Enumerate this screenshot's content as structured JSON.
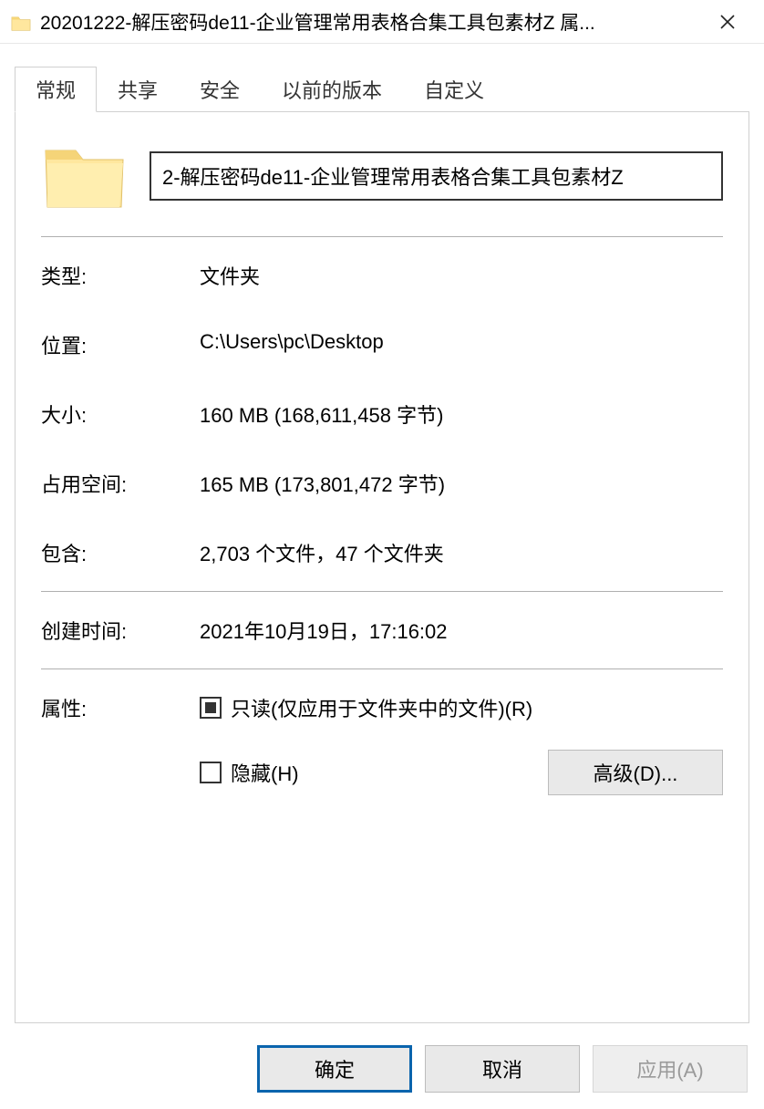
{
  "titlebar": {
    "title": "20201222-解压密码de11-企业管理常用表格合集工具包素材Z 属..."
  },
  "tabs": {
    "general": "常规",
    "sharing": "共享",
    "security": "安全",
    "previous": "以前的版本",
    "custom": "自定义"
  },
  "nameField": "2-解压密码de11-企业管理常用表格合集工具包素材Z",
  "props": {
    "typeLabel": "类型:",
    "typeValue": "文件夹",
    "locationLabel": "位置:",
    "locationValue": "C:\\Users\\pc\\Desktop",
    "sizeLabel": "大小:",
    "sizeValue": "160 MB (168,611,458 字节)",
    "sizeOnDiskLabel": "占用空间:",
    "sizeOnDiskValue": "165 MB (173,801,472 字节)",
    "containsLabel": "包含:",
    "containsValue": "2,703 个文件，47 个文件夹",
    "createdLabel": "创建时间:",
    "createdValue": "2021年10月19日，17:16:02"
  },
  "attributes": {
    "label": "属性:",
    "readonly": "只读(仅应用于文件夹中的文件)(R)",
    "hidden": "隐藏(H)",
    "advanced": "高级(D)..."
  },
  "buttons": {
    "ok": "确定",
    "cancel": "取消",
    "apply": "应用(A)"
  }
}
